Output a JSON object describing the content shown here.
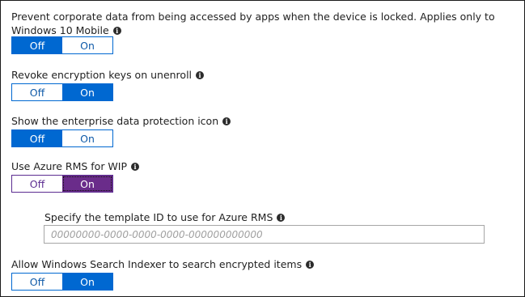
{
  "settings": [
    {
      "label": "Prevent corporate data from being accessed by apps when the device is locked. Applies only to Windows 10 Mobile",
      "off_label": "Off",
      "on_label": "On",
      "selected": "Off"
    },
    {
      "label": "Revoke encryption keys on unenroll",
      "off_label": "Off",
      "on_label": "On",
      "selected": "On"
    },
    {
      "label": "Show the enterprise data protection icon",
      "off_label": "Off",
      "on_label": "On",
      "selected": "Off"
    },
    {
      "label": "Use Azure RMS for WIP",
      "off_label": "Off",
      "on_label": "On",
      "selected": "On"
    },
    {
      "label": "Allow Windows Search Indexer to search encrypted items",
      "off_label": "Off",
      "on_label": "On",
      "selected": "On"
    }
  ],
  "template_id": {
    "label": "Specify the template ID to use for Azure RMS",
    "placeholder": "00000000-0000-0000-0000-000000000000",
    "value": ""
  },
  "icons": {
    "info": "info-icon"
  },
  "colors": {
    "toggle_blue": "#0068d1",
    "toggle_purple": "#6a2c8a",
    "frame_border": "#1a1a1a"
  }
}
